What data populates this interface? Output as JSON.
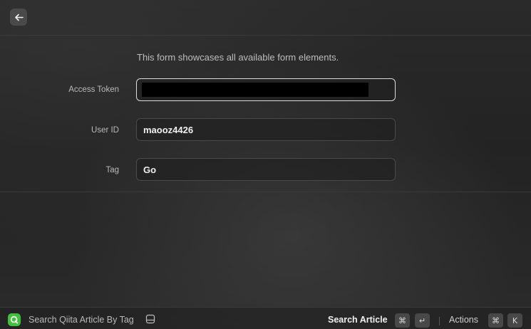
{
  "topbar": {
    "back_icon": "arrow-left-icon"
  },
  "form": {
    "description": "This form showcases all available form elements.",
    "fields": [
      {
        "label": "Access Token",
        "value": "",
        "redacted": true
      },
      {
        "label": "User ID",
        "value": "maooz4426"
      },
      {
        "label": "Tag",
        "value": "Go"
      }
    ]
  },
  "bottombar": {
    "app_icon": "qiita-q-icon",
    "app_name": "Search Qiita Article By Tag",
    "extra_icon": "keyboard-icon",
    "primary_action": "Search Article",
    "primary_shortcut": [
      "⌘",
      "↵"
    ],
    "secondary_action": "Actions",
    "secondary_shortcut": [
      "⌘",
      "K"
    ]
  },
  "colors": {
    "app_icon_bg": "#3ec33a",
    "focus_border": "#dcdcdc"
  }
}
